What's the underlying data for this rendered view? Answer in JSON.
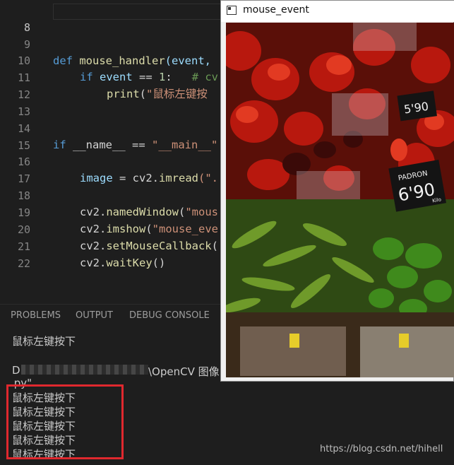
{
  "editor": {
    "lines": [
      {
        "n": "8"
      },
      {
        "n": "9",
        "tokens": [
          "def",
          " ",
          "mouse_handler",
          "(event, "
        ]
      },
      {
        "n": "10",
        "tokens": [
          "if",
          " ",
          "event",
          " == ",
          "1",
          ":   ",
          "# cv"
        ]
      },
      {
        "n": "11",
        "tokens": [
          "print",
          "(",
          "\"鼠标左键按"
        ]
      },
      {
        "n": "12"
      },
      {
        "n": "13"
      },
      {
        "n": "14",
        "tokens": [
          "if",
          " __name__ == ",
          "\"__main__\""
        ]
      },
      {
        "n": "15"
      },
      {
        "n": "16",
        "tokens": [
          "image",
          " = cv2.",
          "imread",
          "(\"."
        ]
      },
      {
        "n": "17"
      },
      {
        "n": "18",
        "tokens": [
          "cv2.",
          "namedWindow",
          "(",
          "\"mous"
        ]
      },
      {
        "n": "19",
        "tokens": [
          "cv2.",
          "imshow",
          "(",
          "\"mouse_eve"
        ]
      },
      {
        "n": "20",
        "tokens": [
          "cv2.",
          "setMouseCallback",
          "("
        ]
      },
      {
        "n": "21",
        "tokens": [
          "cv2.",
          "waitKey",
          "()"
        ]
      },
      {
        "n": "22"
      }
    ]
  },
  "panel": {
    "tabs": [
      "PROBLEMS",
      "OUTPUT",
      "DEBUG CONSOLE"
    ],
    "first_output": "鼠标左键按下",
    "path_prefix": "D",
    "path_suffix": "\\OpenCV 图像",
    "path_end": ".py\"",
    "outputs": [
      "鼠标左键按下",
      "鼠标左键按下",
      "鼠标左键按下",
      "鼠标左键按下",
      "鼠标左键按下"
    ]
  },
  "window": {
    "title": "mouse_event",
    "price_sign": "PADRON",
    "price": "6'90",
    "unit": "Kilo",
    "small_price": "5'90"
  },
  "watermark": "https://blog.csdn.net/hihell",
  "colors": {
    "keyword": "#569cd6",
    "function": "#dcdcaa",
    "string": "#ce9178",
    "number": "#b5cea8",
    "variable": "#9cdcfe",
    "comment": "#6a9955",
    "highlight_box": "#e0282e"
  }
}
